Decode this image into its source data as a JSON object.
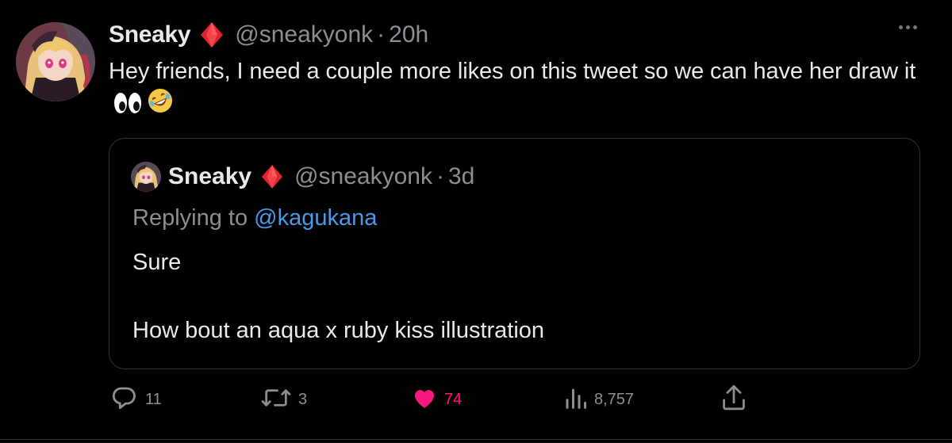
{
  "author": {
    "display_name": "Sneaky",
    "handle": "@sneakyonk",
    "separator": "·",
    "time": "20h",
    "badge_icon": "red-diamond-icon"
  },
  "tweet": {
    "text": "Hey friends, I need a couple more likes on this tweet so we can have her draw it",
    "emojis": [
      "eyes-emoji",
      "rolling-on-floor-laughing-emoji"
    ]
  },
  "quoted_tweet": {
    "display_name": "Sneaky",
    "handle": "@sneakyonk",
    "separator": "·",
    "time": "3d",
    "replying_prefix": "Replying to",
    "replying_to": "@kagukana",
    "line1": "Sure",
    "line2": "How bout an aqua x ruby kiss illustration"
  },
  "actions": {
    "replies": "11",
    "reposts": "3",
    "likes": "74",
    "views": "8,757"
  },
  "colors": {
    "background": "#000000",
    "text": "#e7e9ea",
    "secondary": "#8b8f94",
    "link": "#4a99e9",
    "like": "#f91880",
    "border": "#2f3336"
  }
}
